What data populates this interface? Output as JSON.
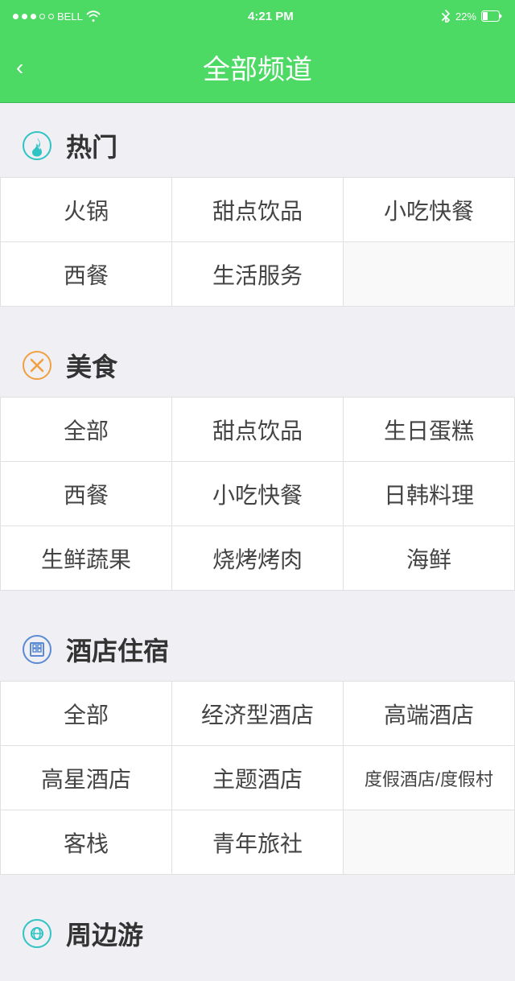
{
  "statusBar": {
    "carrier": "BELL",
    "time": "4:21 PM",
    "battery": "22%"
  },
  "navBar": {
    "title": "全部频道",
    "backLabel": "‹"
  },
  "sections": [
    {
      "id": "hot",
      "title": "热门",
      "iconType": "hot",
      "items": [
        {
          "label": "火锅",
          "wide": false
        },
        {
          "label": "甜点饮品",
          "wide": false
        },
        {
          "label": "小吃快餐",
          "wide": false
        },
        {
          "label": "西餐",
          "wide": false
        },
        {
          "label": "生活服务",
          "wide": false
        }
      ]
    },
    {
      "id": "food",
      "title": "美食",
      "iconType": "food",
      "items": [
        {
          "label": "全部",
          "wide": false
        },
        {
          "label": "甜点饮品",
          "wide": false
        },
        {
          "label": "生日蛋糕",
          "wide": false
        },
        {
          "label": "西餐",
          "wide": false
        },
        {
          "label": "小吃快餐",
          "wide": false
        },
        {
          "label": "日韩料理",
          "wide": false
        },
        {
          "label": "生鲜蔬果",
          "wide": false
        },
        {
          "label": "烧烤烤肉",
          "wide": false
        },
        {
          "label": "海鲜",
          "wide": false
        }
      ]
    },
    {
      "id": "hotel",
      "title": "酒店住宿",
      "iconType": "hotel",
      "items": [
        {
          "label": "全部",
          "wide": false
        },
        {
          "label": "经济型酒店",
          "wide": false
        },
        {
          "label": "高端酒店",
          "wide": false
        },
        {
          "label": "高星酒店",
          "wide": false
        },
        {
          "label": "主题酒店",
          "wide": false
        },
        {
          "label": "度假酒店/度假村",
          "wide": false
        },
        {
          "label": "客栈",
          "wide": false
        },
        {
          "label": "青年旅社",
          "wide": false
        },
        {
          "label": "",
          "wide": false
        }
      ]
    },
    {
      "id": "travel",
      "title": "周边游",
      "iconType": "travel",
      "items": []
    }
  ]
}
